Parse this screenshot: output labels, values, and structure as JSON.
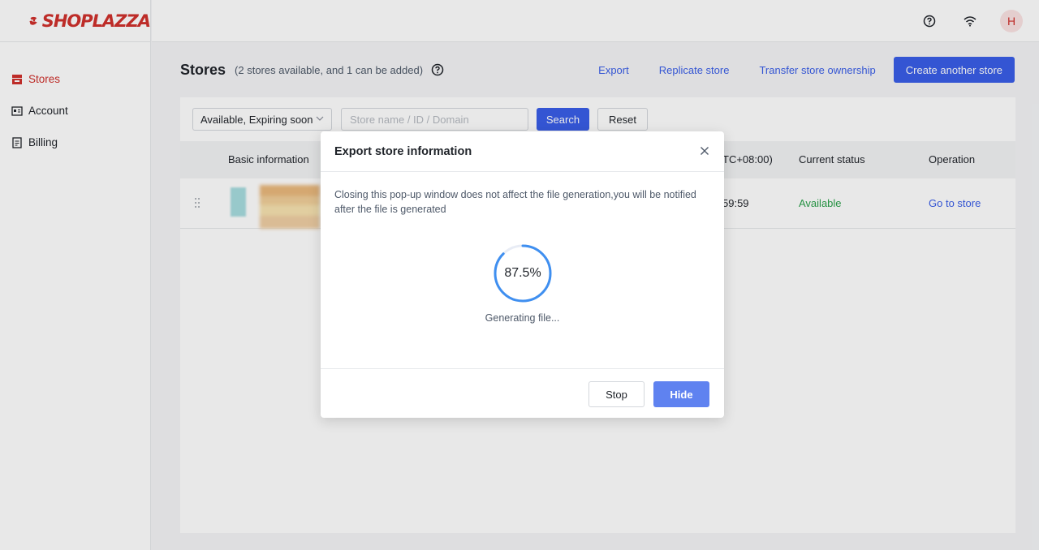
{
  "brand": {
    "logo_text": "SHOPLAZZA",
    "accent": "#d0312d",
    "primary": "#3a5ee8"
  },
  "sidebar": {
    "items": [
      {
        "label": "Stores",
        "icon": "store-icon",
        "active": true
      },
      {
        "label": "Account",
        "icon": "id-card-icon",
        "active": false
      },
      {
        "label": "Billing",
        "icon": "receipt-icon",
        "active": false
      }
    ]
  },
  "topbar": {
    "avatar_initial": "H",
    "icons": [
      "help-icon",
      "wifi-icon"
    ]
  },
  "page": {
    "title": "Stores",
    "subtitle": "(2 stores available, and 1 can be added)",
    "actions": {
      "export": "Export",
      "replicate": "Replicate store",
      "transfer": "Transfer store ownership",
      "create": "Create another store"
    }
  },
  "filters": {
    "status_select": "Available, Expiring soon",
    "search_placeholder": "Store name / ID / Domain",
    "search_label": "Search",
    "reset_label": "Reset"
  },
  "table": {
    "headers": {
      "basic": "Basic information",
      "time": "TC+08:00)",
      "status": "Current status",
      "operation": "Operation"
    },
    "rows": [
      {
        "time": "59:59",
        "status": "Available",
        "operation": "Go to store"
      }
    ]
  },
  "modal": {
    "title": "Export store information",
    "message": "Closing this pop-up window does not affect the file generation,you will be notified after the file is generated",
    "progress": 87.5,
    "progress_label": "87.5%",
    "status": "Generating file...",
    "stop_label": "Stop",
    "hide_label": "Hide"
  }
}
